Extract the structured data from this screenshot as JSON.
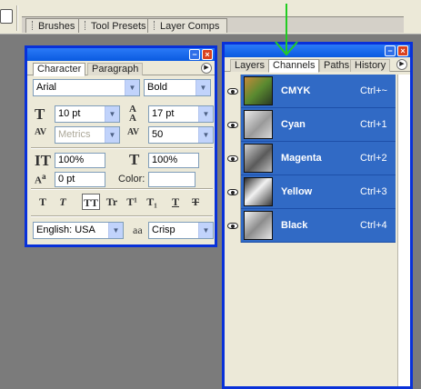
{
  "options_bar": {
    "well_tabs": [
      "Brushes",
      "Tool Presets",
      "Layer Comps"
    ]
  },
  "character_palette": {
    "title_buttons": {
      "minimize": "−",
      "close": "×"
    },
    "tabs": [
      "Character",
      "Paragraph"
    ],
    "menu_glyph": "▶",
    "font_family": "Arial",
    "font_style": "Bold",
    "font_size": "10 pt",
    "leading": "17 pt",
    "kerning": "Metrics",
    "tracking": "50",
    "vertical_scale": "100%",
    "horizontal_scale": "100%",
    "baseline_shift": "0 pt",
    "color_label": "Color:",
    "style_buttons": [
      "T",
      "T",
      "TT",
      "Tr",
      "T¹",
      "T₁",
      "T",
      "T"
    ],
    "language": "English: USA",
    "antialias_icon": "aa",
    "antialias": "Crisp",
    "icons": {
      "size": "font-size-icon",
      "leading": "leading-icon",
      "kerning": "kerning-icon",
      "tracking": "tracking-icon",
      "vscale": "vertical-scale-icon",
      "hscale": "horizontal-scale-icon",
      "baseline": "baseline-shift-icon"
    }
  },
  "channels_palette": {
    "title_buttons": {
      "minimize": "−",
      "close": "×"
    },
    "tabs": [
      "Layers",
      "Channels",
      "Paths",
      "History"
    ],
    "active_tab": "Channels",
    "menu_glyph": "▶",
    "channels": [
      {
        "name": "CMYK",
        "shortcut": "Ctrl+~",
        "thumb_icon": "cmyk-composite-thumbnail"
      },
      {
        "name": "Cyan",
        "shortcut": "Ctrl+1",
        "thumb_icon": "cyan-channel-thumbnail"
      },
      {
        "name": "Magenta",
        "shortcut": "Ctrl+2",
        "thumb_icon": "magenta-channel-thumbnail"
      },
      {
        "name": "Yellow",
        "shortcut": "Ctrl+3",
        "thumb_icon": "yellow-channel-thumbnail"
      },
      {
        "name": "Black",
        "shortcut": "Ctrl+4",
        "thumb_icon": "black-channel-thumbnail"
      }
    ]
  },
  "annotation": {
    "arrow_color": "#22cc22"
  },
  "colors": {
    "selection": "#316ac5",
    "titlebar": "#0a5ae0",
    "palette_bg": "#ece9d8",
    "workspace": "#7b7b7b"
  }
}
